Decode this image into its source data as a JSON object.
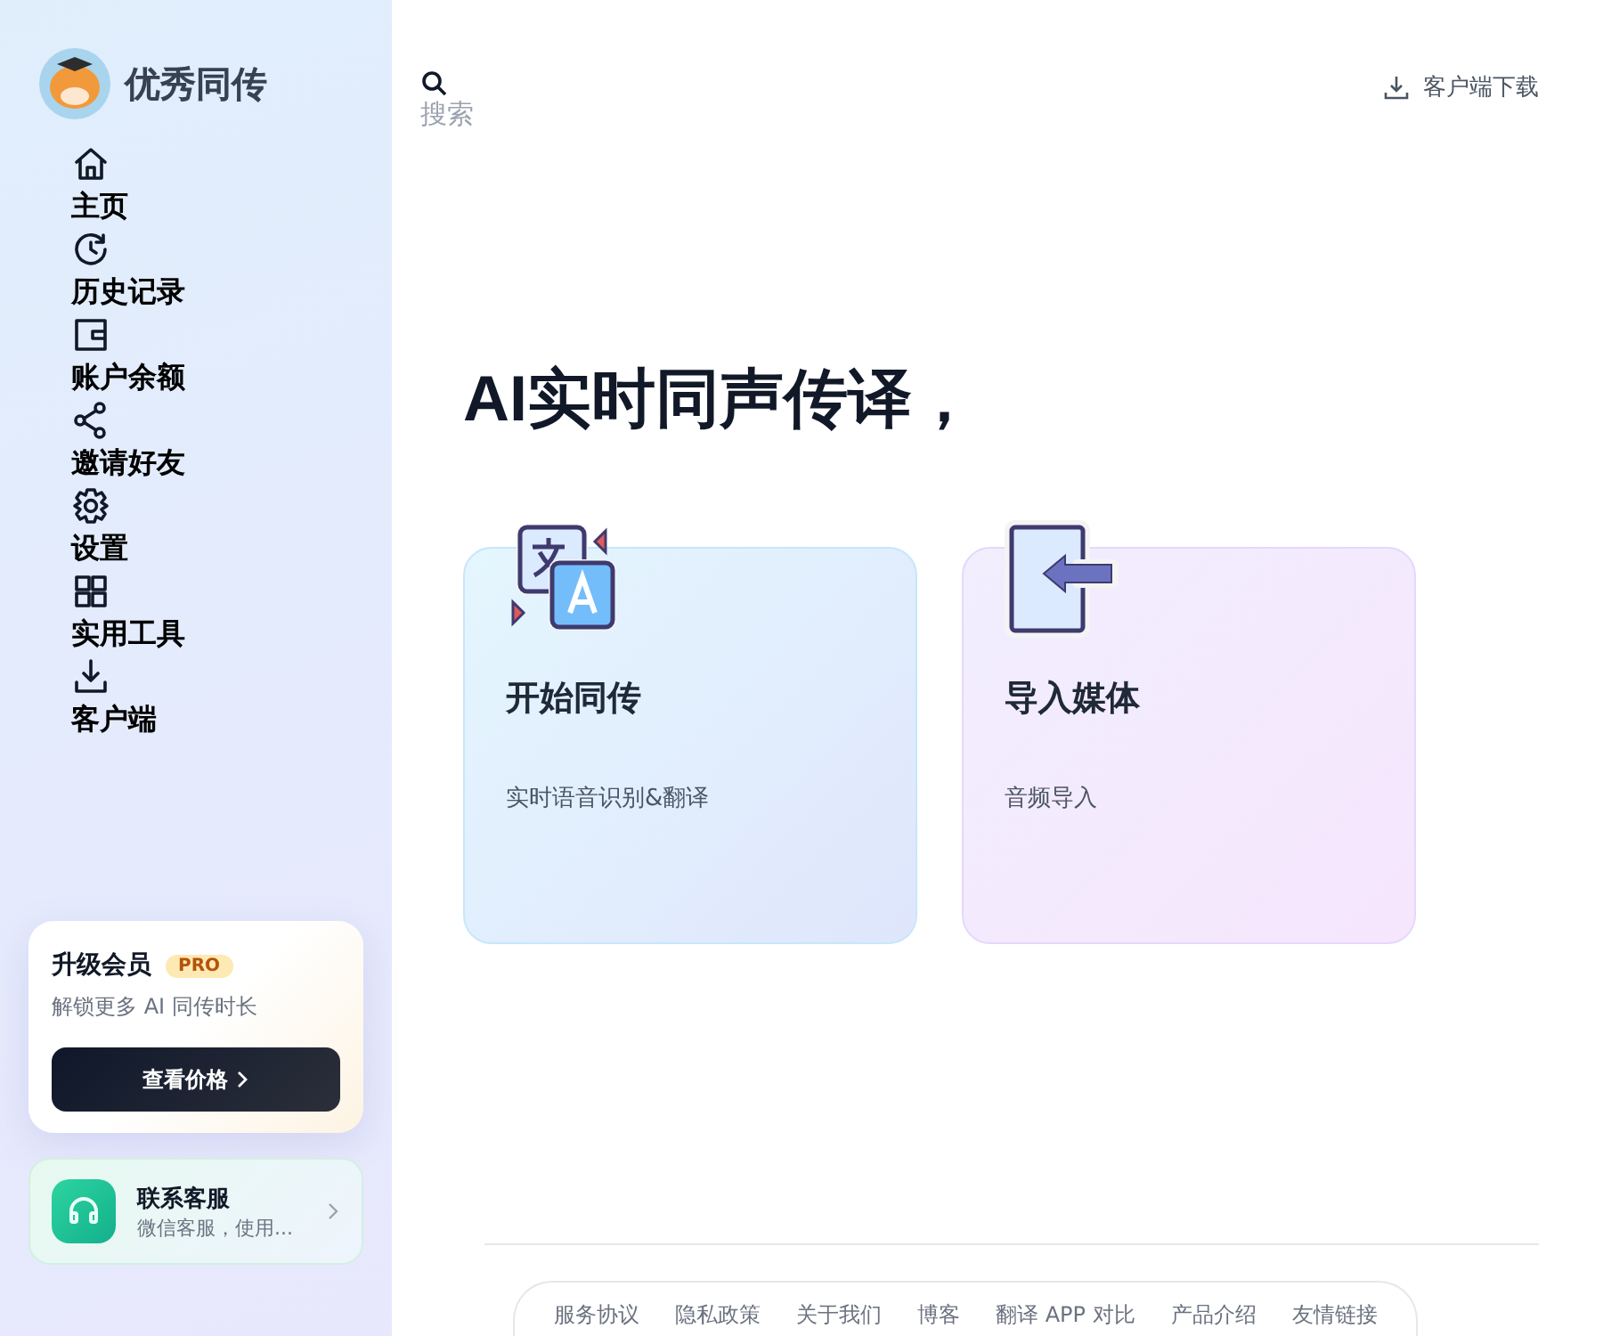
{
  "brand": {
    "name": "优秀同传"
  },
  "nav": [
    {
      "kind": "home",
      "label": "主页"
    },
    {
      "kind": "history",
      "label": "历史记录"
    },
    {
      "kind": "wallet",
      "label": "账户余额"
    },
    {
      "kind": "share",
      "label": "邀请好友"
    },
    {
      "kind": "settings",
      "label": "设置"
    },
    {
      "kind": "grid",
      "label": "实用工具"
    },
    {
      "kind": "download",
      "label": "客户端"
    }
  ],
  "upgrade": {
    "title": "升级会员",
    "badge": "PRO",
    "subtitle": "解锁更多 AI 同传时长",
    "button": "查看价格"
  },
  "support": {
    "title": "联系客服",
    "subtitle": "微信客服，使用..."
  },
  "search": {
    "label": "搜索"
  },
  "download": {
    "label": "客户端下载"
  },
  "headline": "AI实时同声传译，",
  "cards": [
    {
      "kind": "translate",
      "title": "开始同传",
      "subtitle": "实时语音识别&翻译"
    },
    {
      "kind": "import",
      "title": "导入媒体",
      "subtitle": "音频导入"
    }
  ],
  "footer_links": [
    "服务协议",
    "隐私政策",
    "关于我们",
    "博客",
    "翻译 APP 对比",
    "产品介绍",
    "友情链接"
  ]
}
